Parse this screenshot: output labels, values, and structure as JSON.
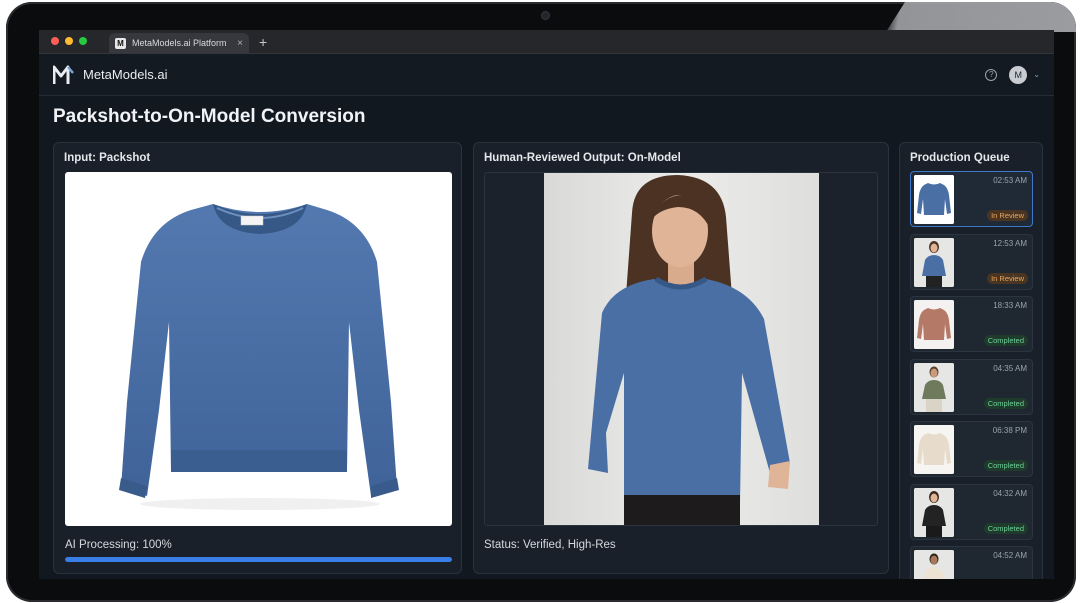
{
  "browser": {
    "tab_title": "MetaModels.ai Platform",
    "tab_favicon": "M",
    "close_glyph": "×",
    "new_tab_glyph": "+"
  },
  "header": {
    "brand": "MetaModels.ai",
    "help_glyph": "?",
    "avatar_initial": "M",
    "chevron_glyph": "⌄"
  },
  "page": {
    "title": "Packshot-to-On-Model Conversion"
  },
  "input_panel": {
    "title": "Input: Packshot",
    "progress_label": "AI Processing: 100%",
    "progress": 1.0,
    "sweater_color": "#4a6fa5"
  },
  "output_panel": {
    "title": "Human-Reviewed Output: On-Model",
    "status": "Status: Verified, High-Res"
  },
  "queue": {
    "title": "Production Queue",
    "items": [
      {
        "time": "02:53 AM",
        "status": "In Review",
        "kind": "review",
        "thumb": "packshot-blue"
      },
      {
        "time": "12:53 AM",
        "status": "In Review",
        "kind": "review",
        "thumb": "model-blue"
      },
      {
        "time": "18:33 AM",
        "status": "Completed",
        "kind": "done",
        "thumb": "packshot-rose"
      },
      {
        "time": "04:35 AM",
        "status": "Completed",
        "kind": "done",
        "thumb": "model-olive"
      },
      {
        "time": "06:38 PM",
        "status": "Completed",
        "kind": "done",
        "thumb": "packshot-cream"
      },
      {
        "time": "04:32 AM",
        "status": "Completed",
        "kind": "done",
        "thumb": "model-black"
      },
      {
        "time": "04:52 AM",
        "status": "",
        "kind": "",
        "thumb": "model-cream"
      }
    ]
  },
  "colors": {
    "accent": "#3a7ee8",
    "background": "#121820",
    "panel": "#192029",
    "review_badge": "#e9a861",
    "done_badge": "#6fd19a"
  }
}
